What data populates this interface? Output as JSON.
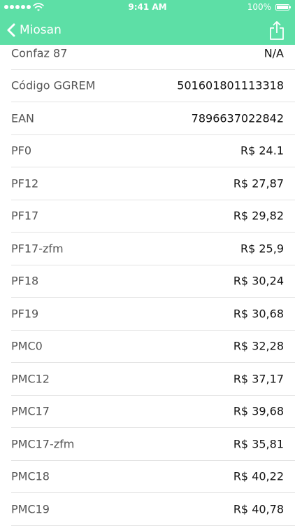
{
  "status_bar": {
    "time": "9:41 AM",
    "battery": "100%"
  },
  "nav": {
    "back_label": "Miosan"
  },
  "rows": [
    {
      "label": "Confaz 87",
      "value": "N/A"
    },
    {
      "label": "Código GGREM",
      "value": "501601801113318"
    },
    {
      "label": "EAN",
      "value": "7896637022842"
    },
    {
      "label": "PF0",
      "value": "R$ 24.1"
    },
    {
      "label": "PF12",
      "value": "R$ 27,87"
    },
    {
      "label": "PF17",
      "value": "R$ 29,82"
    },
    {
      "label": "PF17-zfm",
      "value": "R$ 25,9"
    },
    {
      "label": "PF18",
      "value": "R$ 30,24"
    },
    {
      "label": "PF19",
      "value": "R$ 30,68"
    },
    {
      "label": "PMC0",
      "value": "R$ 32,28"
    },
    {
      "label": "PMC12",
      "value": "R$ 37,17"
    },
    {
      "label": "PMC17",
      "value": "R$ 39,68"
    },
    {
      "label": "PMC17-zfm",
      "value": "R$ 35,81"
    },
    {
      "label": "PMC18",
      "value": "R$ 40,22"
    },
    {
      "label": "PMC19",
      "value": "R$ 40,78"
    }
  ]
}
